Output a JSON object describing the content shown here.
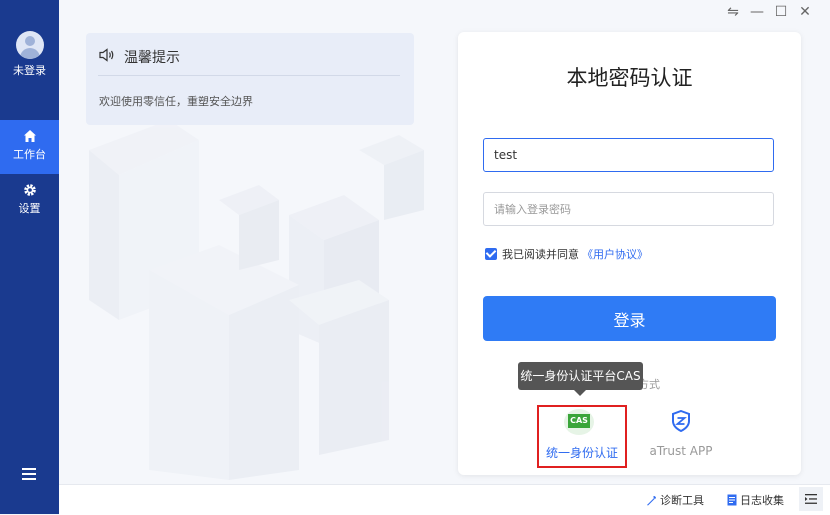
{
  "sidebar": {
    "user_label": "未登录",
    "items": [
      {
        "label": "工作台",
        "icon": "home-icon",
        "active": true
      },
      {
        "label": "设置",
        "icon": "gear-icon",
        "active": false
      }
    ],
    "menu_icon": "menu-icon"
  },
  "window_controls": {
    "swap_icon": "⇋",
    "minimize_icon": "—",
    "maximize_icon": "☐",
    "close_icon": "✕"
  },
  "tip": {
    "title": "温馨提示",
    "icon": "speaker-icon",
    "text": "欢迎使用零信任，重塑安全边界"
  },
  "login": {
    "title": "本地密码认证",
    "username_value": "test",
    "password_placeholder": "请输入登录密码",
    "agree_text": "我已阅读并同意",
    "agreement_link": "《用户协议》",
    "agree_checked": true,
    "login_button": "登录",
    "other_methods_label": "方式",
    "tooltip": "统一身份认证平台CAS",
    "methods": [
      {
        "label": "统一身份认证",
        "icon_text": "CAS",
        "selected": true
      },
      {
        "label": "aTrust APP",
        "icon": "atrust-icon",
        "selected": false
      }
    ]
  },
  "bottombar": {
    "diagnose": "诊断工具",
    "logs": "日志收集",
    "collapse_icon": "collapse-icon"
  },
  "colors": {
    "sidebar": "#1a3a8f",
    "accent": "#2f6bf0",
    "highlight": "#e02020"
  }
}
